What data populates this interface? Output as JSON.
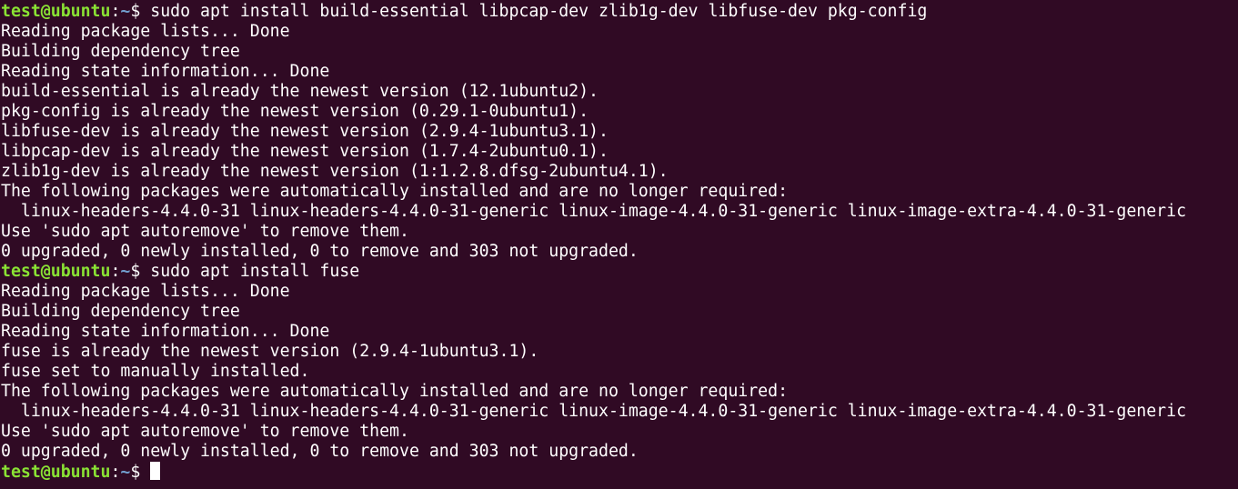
{
  "terminal": {
    "colors": {
      "background": "#300a24",
      "foreground": "#ffffff",
      "user_host": "#8ae234",
      "path": "#729fcf"
    },
    "prompt": {
      "user_host": "test@ubuntu",
      "sep": ":",
      "path": "~",
      "symbol": "$ "
    },
    "lines": [
      {
        "kind": "prompt",
        "command": "sudo apt install build-essential libpcap-dev zlib1g-dev libfuse-dev pkg-config"
      },
      {
        "kind": "output",
        "text": "Reading package lists... Done"
      },
      {
        "kind": "output",
        "text": "Building dependency tree"
      },
      {
        "kind": "output",
        "text": "Reading state information... Done"
      },
      {
        "kind": "output",
        "text": "build-essential is already the newest version (12.1ubuntu2)."
      },
      {
        "kind": "output",
        "text": "pkg-config is already the newest version (0.29.1-0ubuntu1)."
      },
      {
        "kind": "output",
        "text": "libfuse-dev is already the newest version (2.9.4-1ubuntu3.1)."
      },
      {
        "kind": "output",
        "text": "libpcap-dev is already the newest version (1.7.4-2ubuntu0.1)."
      },
      {
        "kind": "output",
        "text": "zlib1g-dev is already the newest version (1:1.2.8.dfsg-2ubuntu4.1)."
      },
      {
        "kind": "output",
        "text": "The following packages were automatically installed and are no longer required:"
      },
      {
        "kind": "output",
        "text": "  linux-headers-4.4.0-31 linux-headers-4.4.0-31-generic linux-image-4.4.0-31-generic linux-image-extra-4.4.0-31-generic"
      },
      {
        "kind": "output",
        "text": "Use 'sudo apt autoremove' to remove them."
      },
      {
        "kind": "output",
        "text": "0 upgraded, 0 newly installed, 0 to remove and 303 not upgraded."
      },
      {
        "kind": "prompt",
        "command": "sudo apt install fuse"
      },
      {
        "kind": "output",
        "text": "Reading package lists... Done"
      },
      {
        "kind": "output",
        "text": "Building dependency tree"
      },
      {
        "kind": "output",
        "text": "Reading state information... Done"
      },
      {
        "kind": "output",
        "text": "fuse is already the newest version (2.9.4-1ubuntu3.1)."
      },
      {
        "kind": "output",
        "text": "fuse set to manually installed."
      },
      {
        "kind": "output",
        "text": "The following packages were automatically installed and are no longer required:"
      },
      {
        "kind": "output",
        "text": "  linux-headers-4.4.0-31 linux-headers-4.4.0-31-generic linux-image-4.4.0-31-generic linux-image-extra-4.4.0-31-generic"
      },
      {
        "kind": "output",
        "text": "Use 'sudo apt autoremove' to remove them."
      },
      {
        "kind": "output",
        "text": "0 upgraded, 0 newly installed, 0 to remove and 303 not upgraded."
      },
      {
        "kind": "prompt",
        "command": "",
        "cursor": true
      }
    ]
  }
}
